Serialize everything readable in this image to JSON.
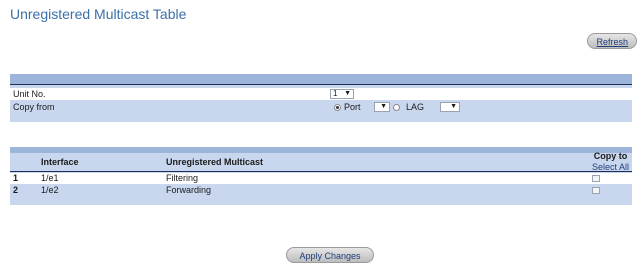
{
  "page": {
    "title": "Unregistered Multicast Table"
  },
  "toolbar": {
    "refresh_label": "Refresh",
    "apply_label": "Apply Changes"
  },
  "form": {
    "unit_label": "Unit No.",
    "unit_value": "1",
    "copy_label": "Copy from",
    "port_label": "Port",
    "port_value": "",
    "lag_label": "LAG",
    "lag_value": "",
    "selected_source": "Port"
  },
  "table": {
    "headers": {
      "interface": "Interface",
      "unregistered_multicast": "Unregistered Multicast",
      "copy_to": "Copy to",
      "select_all": "Select All"
    },
    "rows": [
      {
        "num": "1",
        "interface": "1/e1",
        "mode": "Filtering",
        "copy": false
      },
      {
        "num": "2",
        "interface": "1/e2",
        "mode": "Forwarding",
        "copy": false
      }
    ]
  },
  "colors": {
    "title": "#3d6fa8",
    "panel": "#c9d7ee",
    "panel_band": "#9db4db",
    "link": "#1f3f7a"
  },
  "icons": {
    "dropdown": "chevron-down-icon"
  }
}
